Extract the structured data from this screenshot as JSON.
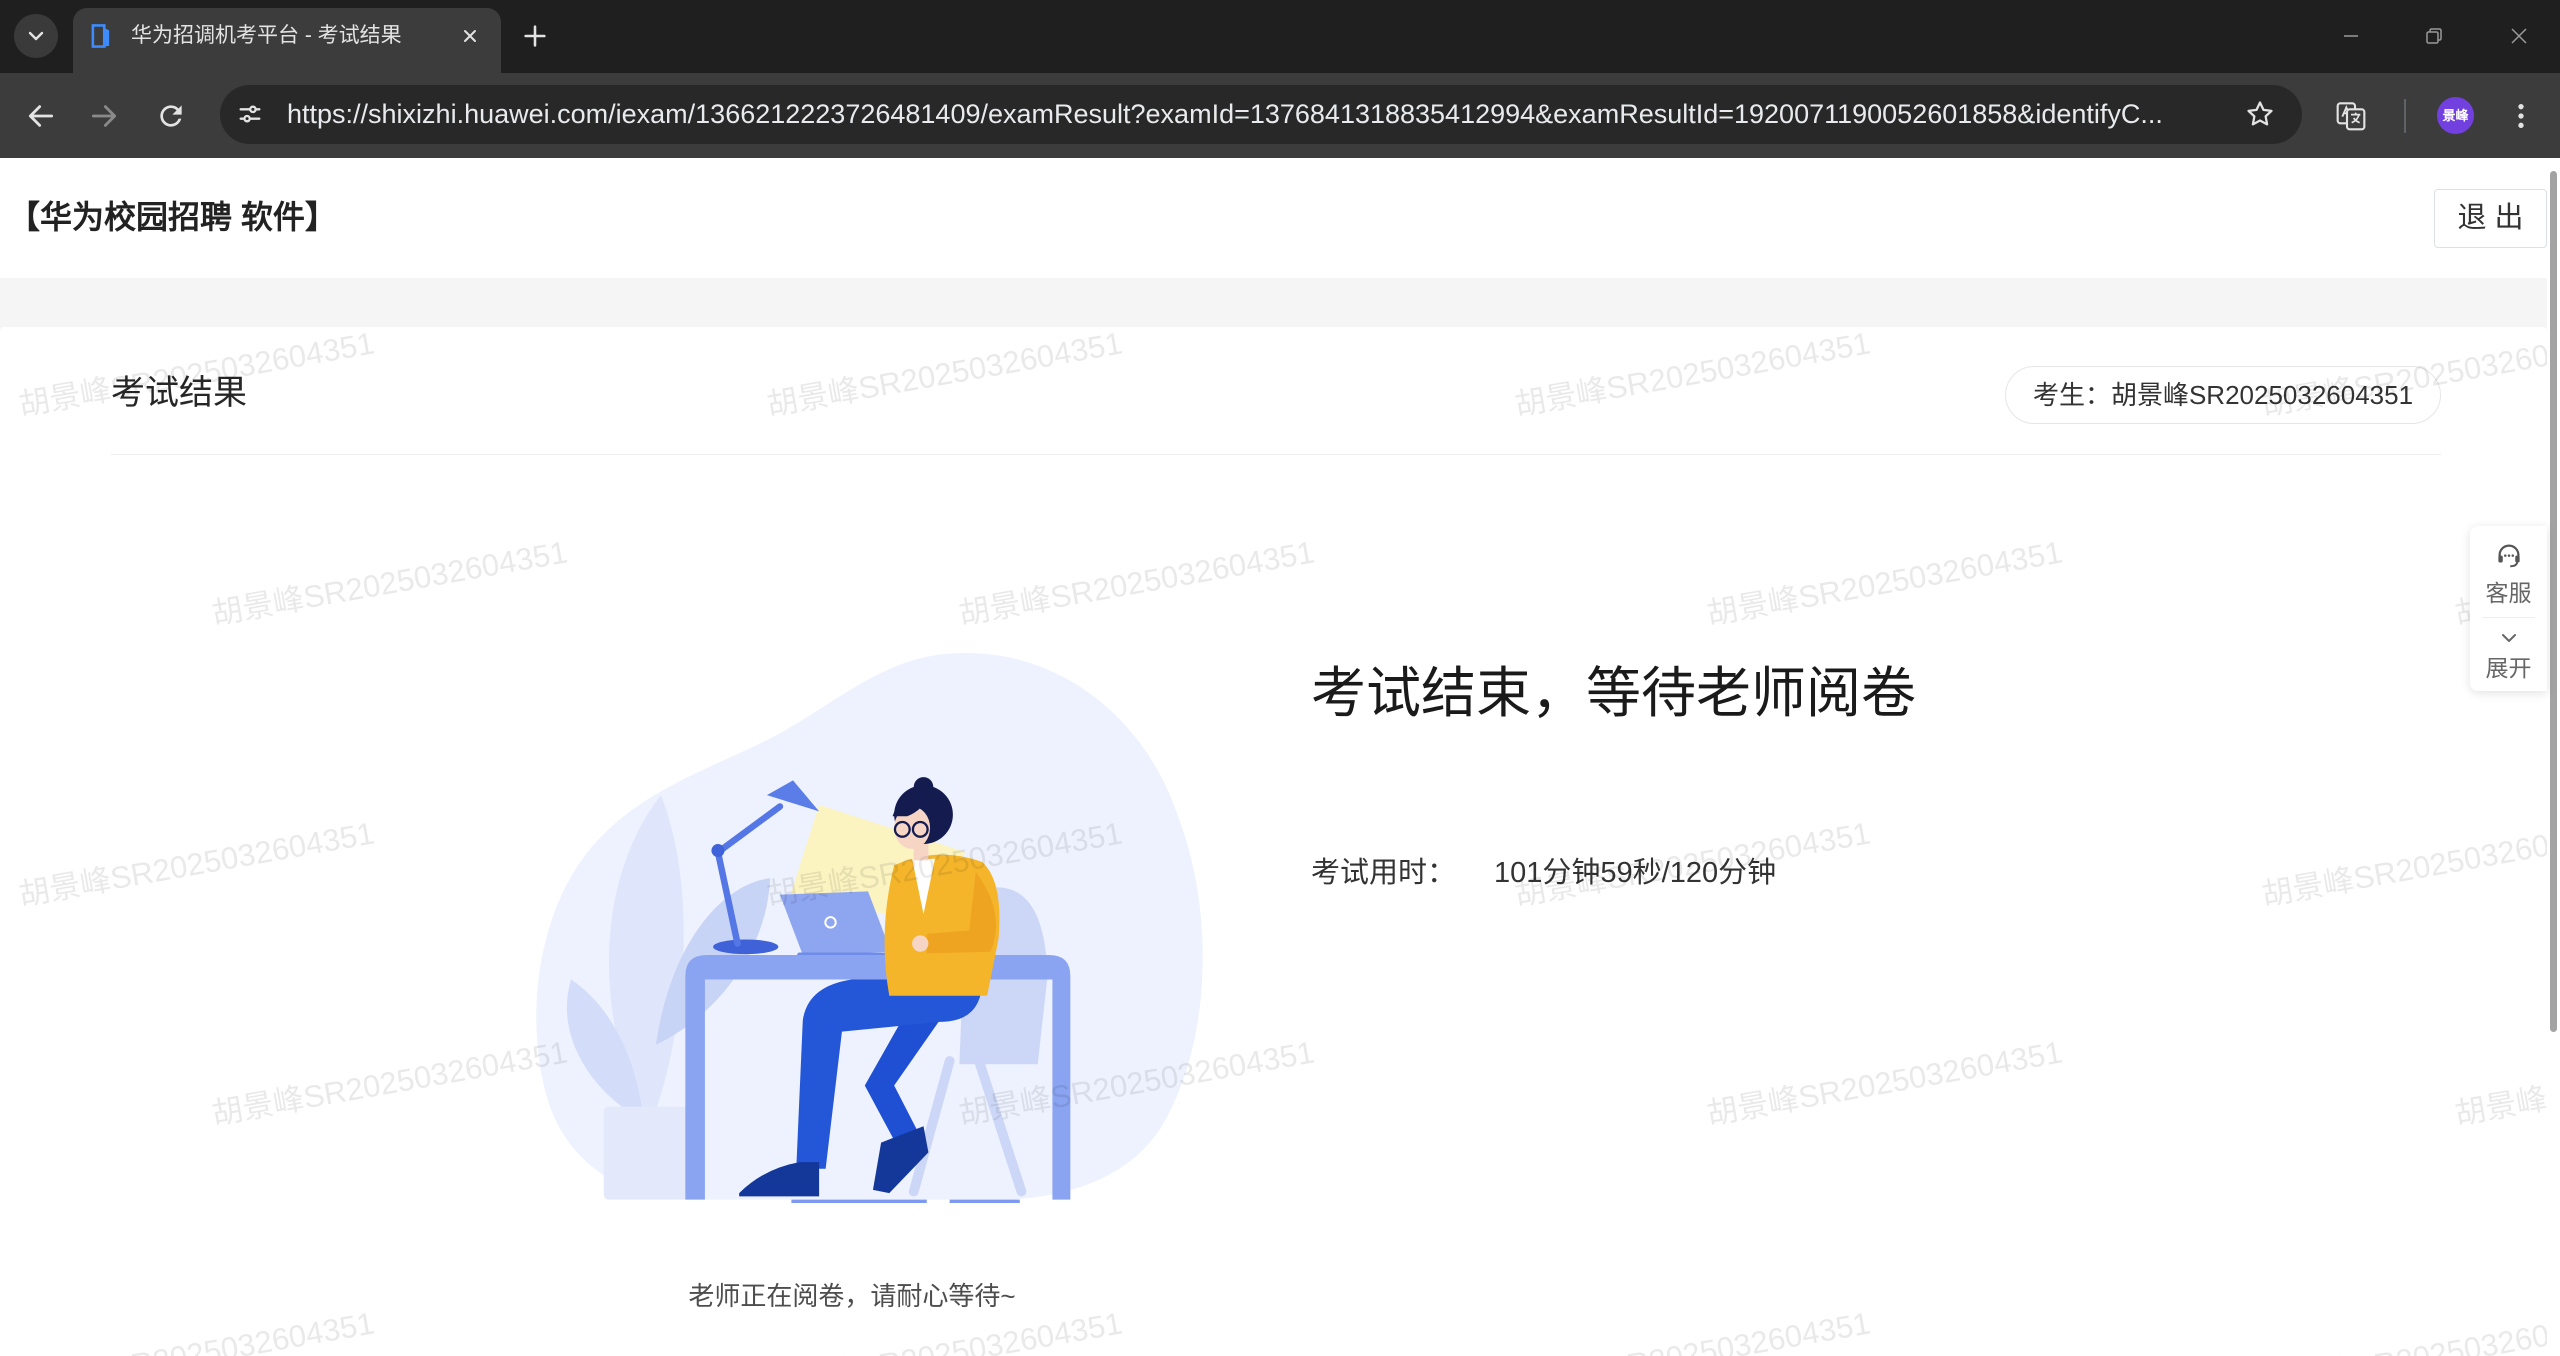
{
  "browser": {
    "tab_title": "华为招调机考平台 - 考试结果",
    "url": "https://shixizhi.huawei.com/iexam/1366212223726481409/examResult?examId=1376841318835412994&examResultId=1920071190052601858&identifyC...",
    "profile_initials": "景峰"
  },
  "header": {
    "title": "【华为校园招聘 软件】",
    "logout_label": "退 出"
  },
  "card": {
    "title": "考试结果",
    "candidate_label": "考生：",
    "candidate_name": "胡景峰SR2025032604351"
  },
  "result": {
    "heading": "考试结束，等待老师阅卷",
    "time_label": "考试用时：",
    "time_value": "101分钟59秒/120分钟",
    "caption": "老师正在阅卷，请耐心等待~"
  },
  "float_widget": {
    "service_label": "客服",
    "expand_label": "展开"
  },
  "watermark": {
    "text": "胡景峰SR2025032604351"
  },
  "icons": {
    "tab_search": "chevron-down-icon",
    "favicon": "book-icon",
    "tab_close": "close-icon",
    "new_tab": "plus-icon",
    "minimize": "minimize-icon",
    "restore": "restore-icon",
    "window_close": "close-icon",
    "back": "back-arrow-icon",
    "forward": "forward-arrow-icon",
    "reload": "reload-icon",
    "site_info": "tune-icon",
    "bookmark": "star-icon",
    "translate": "translate-icon",
    "menu": "more-vert-icon",
    "support": "headset-icon",
    "expand": "chevron-down-icon"
  },
  "colors": {
    "tabstrip_bg": "#1f1f1f",
    "toolbar_bg": "#3c3c3c",
    "omnibox_bg": "#282828",
    "page_bg": "#f5f5f5",
    "profile_bg": "#7340e0",
    "illustration_blue": "#8aa4f2",
    "illustration_yellow": "#f5b52b"
  }
}
